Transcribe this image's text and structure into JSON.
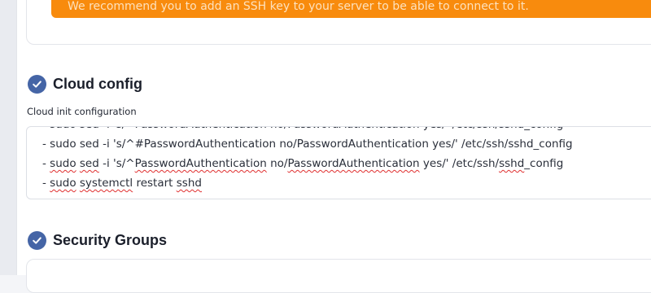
{
  "warning": {
    "text": "We recommend you to add an SSH key to your server to be able to connect to it."
  },
  "cloud_config": {
    "title": "Cloud config",
    "field_label": "Cloud init configuration",
    "lines": [
      "- sudo sed -i 's/^#PasswordAuthentication no/PasswordAuthentication yes/' /etc/ssh/sshd_config",
      "- sudo sed -i 's/^PasswordAuthentication no/PasswordAuthentication yes/' /etc/ssh/sshd_config",
      "- sudo systemctl restart sshd"
    ]
  },
  "security_groups": {
    "title": "Security Groups"
  },
  "icons": {
    "section_check": "check-circle-icon"
  },
  "colors": {
    "accent": "#4565a6",
    "warning": "#f88b0d",
    "spellcheck": "#e03030"
  }
}
